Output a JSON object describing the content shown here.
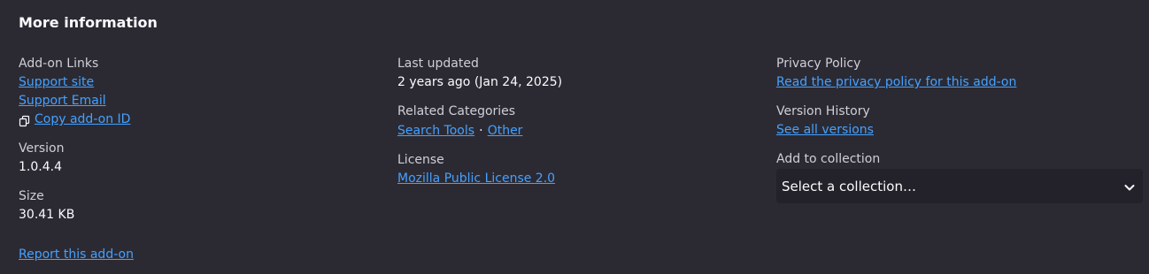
{
  "title": "More information",
  "addon_links": {
    "label": "Add-on Links",
    "support_site": "Support site",
    "support_email": "Support Email",
    "copy_id": "Copy add-on ID"
  },
  "version": {
    "label": "Version",
    "value": "1.0.4.4"
  },
  "size": {
    "label": "Size",
    "value": "30.41 KB"
  },
  "report": "Report this add-on",
  "last_updated": {
    "label": "Last updated",
    "value": "2 years ago (Jan 24, 2025)"
  },
  "related_categories": {
    "label": "Related Categories",
    "items": [
      "Search Tools",
      "Other"
    ],
    "separator": "·"
  },
  "license": {
    "label": "License",
    "value": "Mozilla Public License 2.0"
  },
  "privacy_policy": {
    "label": "Privacy Policy",
    "link": "Read the privacy policy for this add-on"
  },
  "version_history": {
    "label": "Version History",
    "link": "See all versions"
  },
  "collection": {
    "label": "Add to collection",
    "selected": "Select a collection…"
  },
  "colors": {
    "background": "#2b2a33",
    "link": "#45a1ff",
    "label": "#cfcfd8",
    "text": "#fbfbfe",
    "select_bg": "#23222b"
  },
  "icons": {
    "copy": "copy-icon",
    "chevron": "chevron-down-icon"
  }
}
